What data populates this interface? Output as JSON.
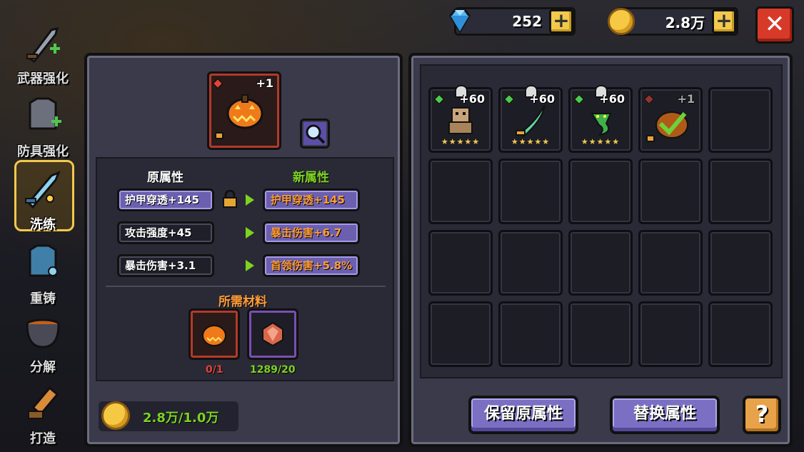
{
  "topbar": {
    "gems": "252",
    "coins": "2.8万",
    "gem_icon": "diamond-icon",
    "coin_icon": "gold-coin-icon",
    "close_icon": "close-icon"
  },
  "nav": [
    {
      "label": "武器强化",
      "icon": "sword-upgrade-icon",
      "active": false
    },
    {
      "label": "防具强化",
      "icon": "armor-upgrade-icon",
      "active": false
    },
    {
      "label": "洗练",
      "icon": "crystal-sword-icon",
      "active": true
    },
    {
      "label": "重铸",
      "icon": "reforge-armor-icon",
      "active": false
    },
    {
      "label": "分解",
      "icon": "cauldron-icon",
      "active": false
    },
    {
      "label": "打造",
      "icon": "forge-hammer-icon",
      "active": false
    }
  ],
  "refine": {
    "item_level": "+1",
    "item_icon": "pumpkin-icon",
    "search_icon": "magnifier-icon",
    "old_header": "原属性",
    "new_header": "新属性",
    "old_stats": [
      "护甲穿透+145",
      "攻击强度+45",
      "暴击伤害+3.1"
    ],
    "new_stats": [
      "护甲穿透+145",
      "暴击伤害+6.7",
      "首领伤害+5.8%"
    ],
    "materials_header": "所需材料",
    "materials": [
      {
        "icon": "pumpkin-material-icon",
        "count": "0/1"
      },
      {
        "icon": "copper-ore-icon",
        "count": "1289/20"
      }
    ],
    "cost": "2.8万/1.0万"
  },
  "inventory": {
    "items": [
      {
        "level": "+60",
        "icon": "golem-icon",
        "stars": "★★★★★"
      },
      {
        "level": "+60",
        "icon": "jade-blade-icon",
        "stars": "★★★★★"
      },
      {
        "level": "+60",
        "icon": "serpent-icon",
        "stars": "★★★★★"
      },
      {
        "level": "+1",
        "icon": "pumpkin-selected-icon",
        "stars": ""
      }
    ],
    "keep_button": "保留原属性",
    "replace_button": "替换属性",
    "help_label": "?"
  },
  "colors": {
    "accent_purple": "#7a6fc2",
    "green_text": "#7ed321",
    "orange_text": "#ff9d3a",
    "gold": "#f2c94c",
    "close_red": "#d83a2a"
  }
}
